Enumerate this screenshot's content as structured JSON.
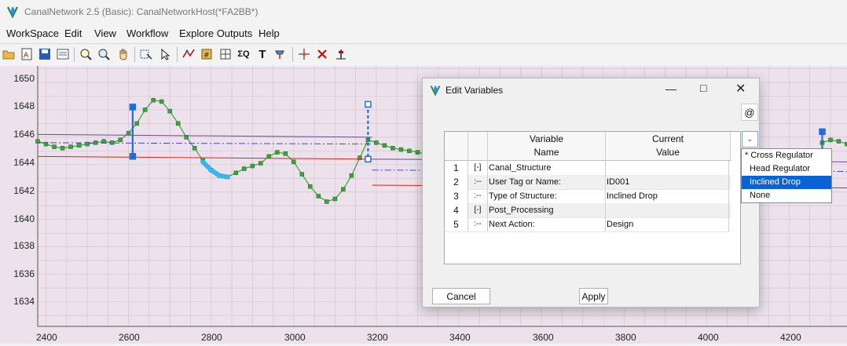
{
  "window": {
    "title": "CanalNetwork 2.5  (Basic): CanalNetworkHost(*FA2BB*)"
  },
  "menu": [
    "WorkSpace",
    "Edit",
    "View",
    "Workflow",
    "Explore Outputs",
    "Help"
  ],
  "toolbar": {
    "icons": [
      "open-folder-icon",
      "new-doc-icon",
      "save-icon",
      "properties-icon",
      "zoom-in-icon",
      "zoom-icon",
      "pan-hand-icon",
      "select-icon",
      "pointer-icon",
      "edit-profile-icon",
      "calculate-icon",
      "grid-icon",
      "sigma-icon",
      "text-icon",
      "paint-icon",
      "crosshair-icon",
      "delete-point-icon",
      "marker-icon"
    ]
  },
  "chart_data": {
    "type": "line",
    "xticks": [
      "2400",
      "2600",
      "2800",
      "3000",
      "3200",
      "3400",
      "3600",
      "3800",
      "4000",
      "4200"
    ],
    "yticks": [
      "1650",
      "1648",
      "1646",
      "1644",
      "1642",
      "1640",
      "1638",
      "1636",
      "1634"
    ],
    "xlim": [
      2380,
      4340
    ],
    "ylim": [
      1632.2,
      1651.2
    ],
    "series": [
      {
        "color": "#3aa33a",
        "x": [
          2380,
          2400,
          2420,
          2440,
          2460,
          2480,
          2500,
          2520,
          2540,
          2560,
          2580,
          2600,
          2620,
          2640,
          2660,
          2680,
          2700,
          2720,
          2740,
          2760,
          2780,
          2800,
          2820,
          2840,
          2860,
          2880,
          2900,
          2920,
          2940,
          2960,
          2980,
          3000,
          3020,
          3040,
          3060,
          3080,
          3100,
          3120,
          3140,
          3160,
          3180,
          3200,
          3220,
          3240,
          3260,
          3280,
          3300,
          3320
        ],
        "y": [
          1645.7,
          1645.5,
          1645.3,
          1645.2,
          1645.3,
          1645.4,
          1645.5,
          1645.6,
          1645.7,
          1645.6,
          1645.8,
          1646.3,
          1647.0,
          1648.0,
          1648.7,
          1648.6,
          1647.9,
          1647.0,
          1646.0,
          1645.2,
          1644.3,
          1643.6,
          1643.2,
          1643.1,
          1643.4,
          1643.7,
          1643.9,
          1644.1,
          1644.6,
          1644.9,
          1644.8,
          1644.2,
          1643.3,
          1642.4,
          1641.7,
          1641.3,
          1641.5,
          1642.2,
          1643.2,
          1644.5,
          1645.8,
          1645.6,
          1645.4,
          1645.2,
          1645.1,
          1645.0,
          1644.9,
          1644.8
        ]
      },
      {
        "color": "#6b4c8a",
        "x": [
          2380,
          3190
        ],
        "y": [
          1646.2,
          1646.0
        ]
      },
      {
        "color": "#4444dd",
        "x": [
          2380,
          3190
        ],
        "y": [
          1645.6,
          1645.5
        ]
      },
      {
        "color": "#dd2222",
        "x": [
          2380,
          3190
        ],
        "y": [
          1644.6,
          1644.4
        ]
      },
      {
        "color": "#6b4c8a",
        "x": [
          3190,
          4340
        ],
        "y": [
          1644.4,
          1644.2
        ]
      },
      {
        "color": "#4444dd",
        "x": [
          3190,
          4340
        ],
        "y": [
          1643.6,
          1643.5
        ]
      },
      {
        "color": "#dd2222",
        "x": [
          3190,
          4340
        ],
        "y": [
          1642.5,
          1642.3
        ]
      },
      {
        "color": "#3aa33a",
        "x": [
          4280,
          4300,
          4320,
          4340
        ],
        "y": [
          1645.6,
          1645.8,
          1645.7,
          1645.5
        ]
      }
    ],
    "highlight": {
      "color": "#38b6ea",
      "x": [
        2780,
        2800,
        2820,
        2840
      ],
      "y": [
        1644.2,
        1643.6,
        1643.2,
        1643.1
      ]
    },
    "structures": [
      {
        "x": 2610,
        "y_top": 1648.2,
        "y_bottom": 1644.6,
        "style": "solid"
      },
      {
        "x": 3180,
        "y_top": 1648.4,
        "y_bottom": 1644.4,
        "style": "dashed"
      },
      {
        "x": 4280,
        "y_top": 1646.4,
        "y_bottom": 1644.8,
        "style": "solid"
      }
    ],
    "grid": true
  },
  "dialog": {
    "title": "Edit Variables",
    "at_label": "@",
    "headers": {
      "name_line1": "Variable",
      "name_line2": "Name",
      "value_line1": "Current",
      "value_line2": "Value"
    },
    "rows": [
      {
        "num": "1",
        "tree": "[-]",
        "name": "Canal_Structure",
        "value": ""
      },
      {
        "num": "2",
        "tree": ":--",
        "name": "User Tag or Name:",
        "value": "ID001"
      },
      {
        "num": "3",
        "tree": ":--",
        "name": "Type of Structure:",
        "value": "Inclined Drop"
      },
      {
        "num": "4",
        "tree": "[-]",
        "name": "Post_Processing",
        "value": ""
      },
      {
        "num": "5",
        "tree": ":--",
        "name": "Next Action:",
        "value": "Design"
      }
    ],
    "cancel_label": "Cancel",
    "apply_label": "Apply"
  },
  "dropdown": {
    "options": [
      "* Cross Regulator",
      "Head Regulator",
      "Inclined Drop",
      "None"
    ],
    "selected_index": 2
  }
}
